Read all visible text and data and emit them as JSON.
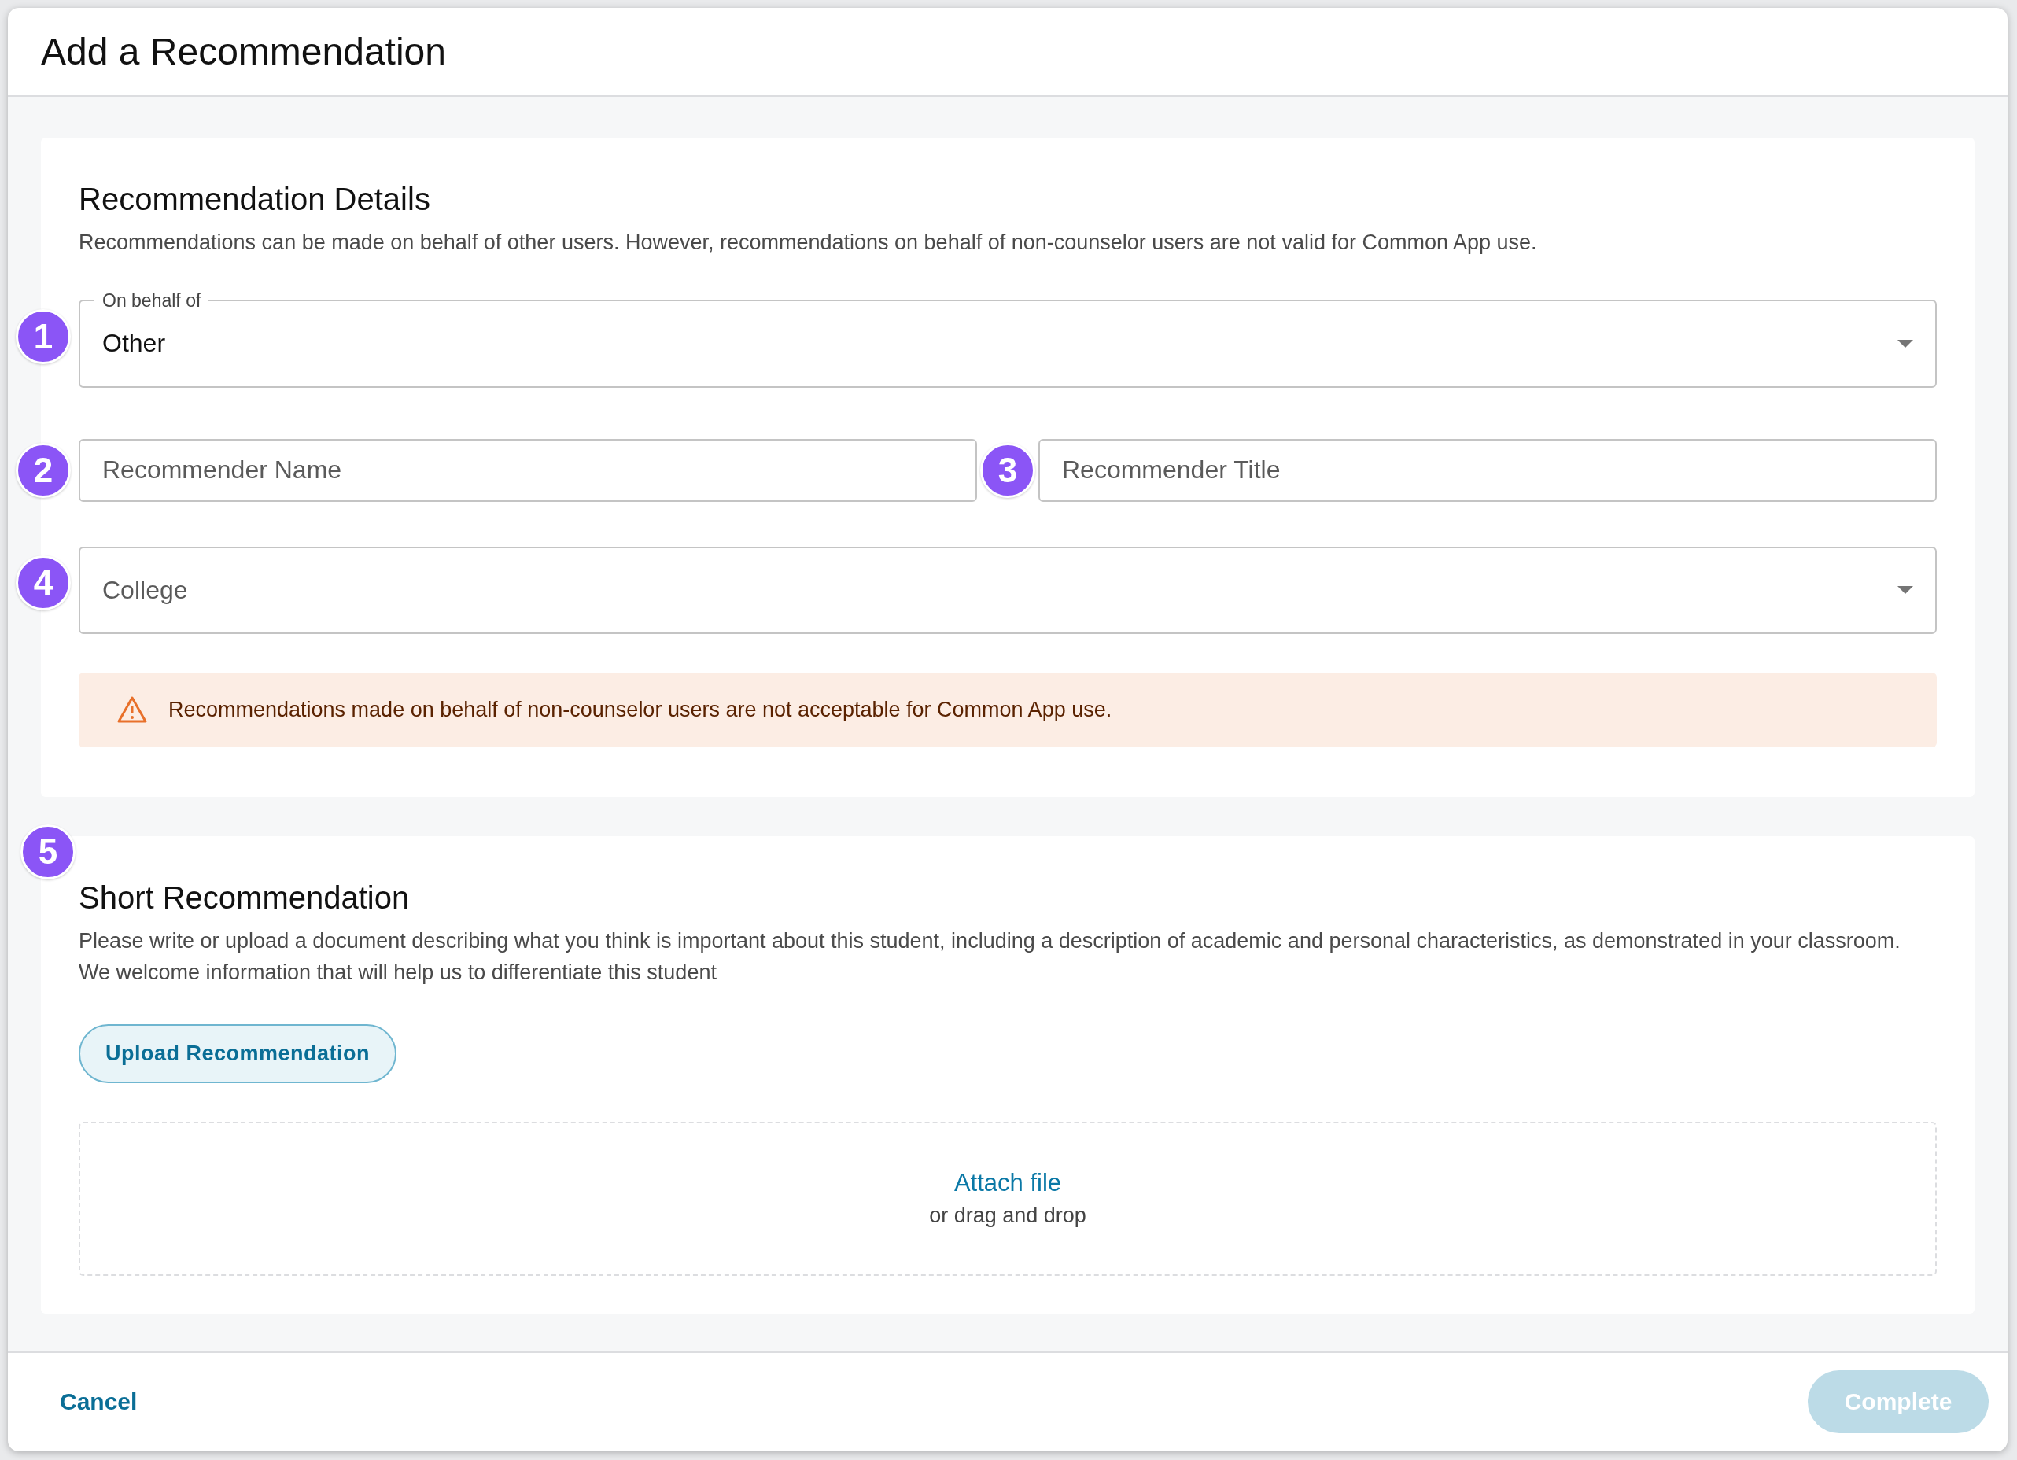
{
  "dialog": {
    "title": "Add a Recommendation"
  },
  "details": {
    "heading": "Recommendation Details",
    "description": "Recommendations can be made on behalf of other users. However, recommendations on behalf of non-counselor users are not valid for Common App use.",
    "rows": [
      [
        {
          "kind": "select",
          "marker": "1",
          "label": "On behalf of",
          "value": "Other"
        }
      ],
      [
        {
          "kind": "text",
          "marker": "2",
          "placeholder": "Recommender Name"
        },
        {
          "kind": "text",
          "marker": "3",
          "placeholder": "Recommender Title"
        }
      ],
      [
        {
          "kind": "select",
          "marker": "4",
          "placeholder": "College"
        }
      ]
    ],
    "warning": {
      "text": "Recommendations made on behalf of non-counselor users are not acceptable for Common App use."
    }
  },
  "short": {
    "marker": "5",
    "heading": "Short Recommendation",
    "description": "Please write or upload a document describing what you think is important about this student, including a description of academic and personal characteristics, as demonstrated in your classroom. We welcome information that will help us to differentiate this student",
    "upload_button": "Upload Recommendation",
    "dropzone": {
      "link": "Attach file",
      "hint": "or drag and drop"
    }
  },
  "footer": {
    "cancel": "Cancel",
    "complete": {
      "label": "Complete",
      "disabled": true
    }
  }
}
